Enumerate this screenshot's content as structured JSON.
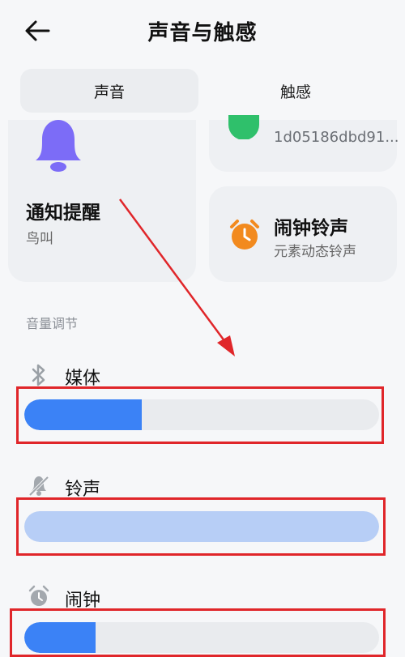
{
  "header": {
    "title": "声音与触感",
    "back_icon": "arrow-left-icon"
  },
  "tabs": [
    {
      "label": "声音",
      "active": true
    },
    {
      "label": "触感",
      "active": false
    }
  ],
  "cards": {
    "notification": {
      "title": "通知提醒",
      "subtitle": "鸟叫",
      "icon": "bell-icon",
      "icon_color": "#7c6cf7"
    },
    "ringtone_partial": {
      "subtitle": "1d05186dbd91...",
      "icon": "phone-icon",
      "icon_color": "#2fc06b"
    },
    "alarm": {
      "title": "闹钟铃声",
      "subtitle": "元素动态铃声",
      "icon": "alarm-clock-icon",
      "icon_color": "#f28a1e"
    }
  },
  "volume": {
    "section_label": "音量调节",
    "rows": [
      {
        "label": "媒体",
        "icon": "bluetooth-icon",
        "level": 0.33
      },
      {
        "label": "铃声",
        "icon": "bell-muted-icon",
        "level": 1.0
      },
      {
        "label": "闹钟",
        "icon": "alarm-clock-icon",
        "level": 0.2
      }
    ]
  },
  "colors": {
    "accent": "#3b82f6",
    "accent_light": "#b7cef6",
    "annotation_red": "#e0262a"
  }
}
